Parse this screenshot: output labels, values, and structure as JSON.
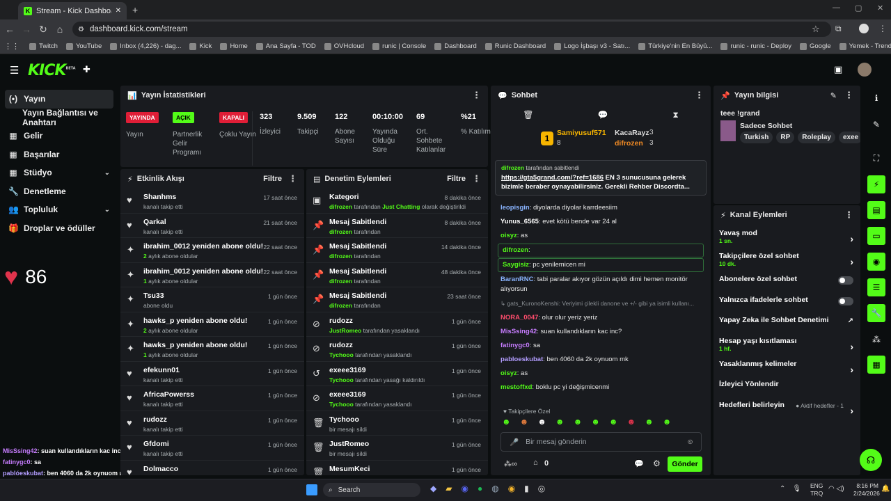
{
  "browser": {
    "tab_title": "Stream - Kick Dashboard",
    "url": "dashboard.kick.com/stream",
    "bookmarks": [
      "Twitch",
      "YouTube",
      "Inbox (4,226) - dag...",
      "Kick",
      "Home",
      "Ana Sayfa - TOD",
      "OVHcloud",
      "runic | Console",
      "Dashboard",
      "Runic Dashboard",
      "Logo İşbaşı v3 - Satı...",
      "Türkiye'nin En Büyü...",
      "runic - runic - Deploy",
      "Google",
      "Yemek - Trendyol Go"
    ]
  },
  "header": {
    "logo": "KICK",
    "beta": "BETA"
  },
  "sidebar": {
    "items": [
      {
        "icon": "(•)",
        "label": "Yayın",
        "active": true
      },
      {
        "icon": "",
        "label": "Yayın Bağlantısı ve Anahtarı"
      },
      {
        "icon": "▦",
        "label": "Gelir"
      },
      {
        "icon": "▦",
        "label": "Başarılar"
      },
      {
        "icon": "▦",
        "label": "Stüdyo",
        "chev": "⌄"
      },
      {
        "icon": "🔧",
        "label": "Denetleme"
      },
      {
        "icon": "👥",
        "label": "Topluluk",
        "chev": "⌄"
      },
      {
        "icon": "🎁",
        "label": "Droplar ve ödüller"
      }
    ],
    "heart_rate": "86"
  },
  "overlay_chat": [
    {
      "name": "MisSsing42",
      "text": ": suan kullandıkların kac inc?",
      "color": "#c77dff"
    },
    {
      "name": "fatinygc0",
      "text": ": sa",
      "color": "#c77dff"
    },
    {
      "name": "pablóeskubat",
      "text": ": ben 4060 da 2k oynuom mk",
      "color": "#b39dff"
    },
    {
      "name": "oisyz",
      "text": ": as",
      "color": "#53fc18"
    },
    {
      "name": "mestoffxd",
      "text": ": boklu pc yi değişmicenmi",
      "color": "#53fc18"
    }
  ],
  "stats": {
    "title": "Yayın İstatistikleri",
    "badges": [
      {
        "text": "YAYINDA",
        "label": "Yayın",
        "bg": "#e01e37",
        "fg": "#fff"
      },
      {
        "text": "AÇIK",
        "label": "Partnerlik Gelir Programı",
        "bg": "#53fc18",
        "fg": "#000"
      },
      {
        "text": "KAPALI",
        "label": "Çoklu Yayın",
        "bg": "#e01e37",
        "fg": "#fff"
      }
    ],
    "values": [
      {
        "v": "323",
        "l": "İzleyici"
      },
      {
        "v": "9.509",
        "l": "Takipçi"
      },
      {
        "v": "122",
        "l": "Abone Sayısı"
      },
      {
        "v": "00:10:00",
        "l": "Yayında Olduğu Süre"
      },
      {
        "v": "69",
        "l": "Ort. Sohbete Katılanlar"
      },
      {
        "v": "%21",
        "l": "% Katılım"
      }
    ]
  },
  "activity": {
    "title": "Etkinlik Akışı",
    "filter": "Filtre",
    "rows": [
      {
        "icon": "♥",
        "t": "Shanhms",
        "s": "kanalı takip etti",
        "time": "17 saat önce"
      },
      {
        "icon": "♥",
        "t": "Qarkal",
        "s": "kanalı takip etti",
        "time": "21 saat önce"
      },
      {
        "icon": "✦",
        "t": "ibrahim_0012 yeniden abone oldu!",
        "s2": "2",
        "s": " aylık abone oldular",
        "time": "22 saat önce"
      },
      {
        "icon": "✦",
        "t": "ibrahim_0012 yeniden abone oldu!",
        "s2": "1",
        "s": " aylık abone oldular",
        "time": "22 saat önce"
      },
      {
        "icon": "✦",
        "t": "Tsu33",
        "s": "abone oldu",
        "time": "1 gün önce"
      },
      {
        "icon": "✦",
        "t": "hawks_p yeniden abone oldu!",
        "s2": "2",
        "s": " aylık abone oldular",
        "time": "1 gün önce"
      },
      {
        "icon": "✦",
        "t": "hawks_p yeniden abone oldu!",
        "s2": "1",
        "s": " aylık abone oldular",
        "time": "1 gün önce"
      },
      {
        "icon": "♥",
        "t": "efekunn01",
        "s": "kanalı takip etti",
        "time": "1 gün önce"
      },
      {
        "icon": "♥",
        "t": "AfricaPowerss",
        "s": "kanalı takip etti",
        "time": "1 gün önce"
      },
      {
        "icon": "♥",
        "t": "rudozz",
        "s": "kanalı takip etti",
        "time": "1 gün önce"
      },
      {
        "icon": "♥",
        "t": "Gfdomi",
        "s": "kanalı takip etti",
        "time": "1 gün önce"
      },
      {
        "icon": "♥",
        "t": "Dolmacco",
        "s": "",
        "time": "1 gün önce"
      }
    ]
  },
  "moderation": {
    "title": "Denetim Eylemleri",
    "filter": "Filtre",
    "rows": [
      {
        "icon": "▣",
        "t": "Kategori",
        "g": "difrozen",
        "s": " tarafından ",
        "g2": "Just Chatting",
        "s3": " olarak değiştirildi",
        "time": "8 dakika önce"
      },
      {
        "icon": "📌",
        "t": "Mesaj Sabitlendi",
        "g": "difrozen",
        "s": " tarafından",
        "time": "8 dakika önce"
      },
      {
        "icon": "📌",
        "t": "Mesaj Sabitlendi",
        "g": "difrozen",
        "s": " tarafından",
        "time": "14 dakika önce"
      },
      {
        "icon": "📌",
        "t": "Mesaj Sabitlendi",
        "g": "difrozen",
        "s": " tarafından",
        "time": "48 dakika önce"
      },
      {
        "icon": "📌",
        "t": "Mesaj Sabitlendi",
        "g": "difrozen",
        "s": " tarafından",
        "time": "23 saat önce"
      },
      {
        "icon": "⊘",
        "t": "rudozz",
        "g": "JustRomeo",
        "s": " tarafından yasaklandı",
        "time": "1 gün önce"
      },
      {
        "icon": "⊘",
        "t": "rudozz",
        "g": "Tychooo",
        "s": " tarafından yasaklandı",
        "time": "1 gün önce"
      },
      {
        "icon": "↺",
        "t": "exeee3169",
        "g": "Tychooo",
        "s": " tarafından yasağı kaldırıldı",
        "time": "1 gün önce"
      },
      {
        "icon": "⊘",
        "t": "exeee3169",
        "g": "Tychooo",
        "s": " tarafından yasaklandı",
        "time": "1 gün önce"
      },
      {
        "icon": "🗑",
        "t": "Tychooo",
        "s": "bir mesajı sildi",
        "time": "1 gün önce"
      },
      {
        "icon": "🗑",
        "t": "JustRomeo",
        "s": "bir mesajı sildi",
        "time": "1 gün önce"
      },
      {
        "icon": "🗑",
        "t": "MesumKeci",
        "s": "",
        "time": "1 gün önce"
      }
    ]
  },
  "chat": {
    "title": "Sohbet",
    "top": [
      {
        "name": "Samiyusuf571",
        "rank": "8"
      },
      {
        "name": "KacaRayz",
        "rank": "3"
      },
      {
        "name": "difrozen",
        "rank": "3"
      }
    ],
    "pinned_by": "difrozen",
    "pinned_suffix": " tarafından sabitlendi",
    "pinned_link": "https://gta5grand.com/?ref=1686",
    "pinned_text": " EN 3 sunucusuna gelerek bizimle beraber oynayabilirsiniz. Gerekli Rehber Discordta...",
    "messages": [
      {
        "name": "leopisgin",
        "color": "#8ab4ff",
        "text": ": diyolarda diyolar karrdeesiim"
      },
      {
        "name": "Yunus_6565",
        "color": "#ffffff",
        "text": ": evet kötü bende var 24 al"
      },
      {
        "name": "oisyz",
        "color": "#53fc18",
        "text": ": as"
      },
      {
        "name": "difrozen",
        "color": "#53fc18",
        "text": ":"
      },
      {
        "name": "Saygisiz",
        "color": "#53fc18",
        "text": ": pc yenilemicen mi"
      },
      {
        "name": "BaranRNC",
        "color": "#8ab4ff",
        "text": ": tabi paralar akıyor gözün açıldı dimi hemen monitör alıyorsun"
      },
      {
        "reply": "↳ gats_KuronoKenshi: Veriyimi çilekli danone ve +/- gibi ya isimli kullanı..."
      },
      {
        "name": "NORA_0047",
        "color": "#ff4d6d",
        "text": ": olur olur yeriz yeriz"
      },
      {
        "name": "MisSsing42",
        "color": "#c77dff",
        "text": ": suan kullandıkların kac inc?"
      },
      {
        "name": "fatinygc0",
        "color": "#c77dff",
        "text": ": sa"
      },
      {
        "name": "pabloeskubat",
        "color": "#b39dff",
        "text": ": ben 4060 da 2k oynuom mk"
      },
      {
        "name": "oisyz",
        "color": "#53fc18",
        "text": ": as"
      },
      {
        "name": "mestoffxd",
        "color": "#53fc18",
        "text": ": boklu pc yi değişmicenmi"
      }
    ],
    "followers_only": "Takipçilere Özel",
    "placeholder": "Bir mesaj gönderin",
    "send": "Gönder",
    "count": "0"
  },
  "stream_info": {
    "title": "Yayın bilgisi",
    "stream_title": "teee !grand",
    "category": "Sadece Sohbet",
    "tags": [
      "Turkish",
      "RP",
      "Roleplay",
      "exee"
    ]
  },
  "channel_actions": {
    "title": "Kanal Eylemleri",
    "items": [
      {
        "label": "Yavaş mod",
        "sub": "1 sn.",
        "type": "arrow"
      },
      {
        "label": "Takipçilere özel sohbet",
        "sub": "10 dk.",
        "type": "arrow"
      },
      {
        "label": "Abonelere özel sohbet",
        "type": "toggle"
      },
      {
        "label": "Yalnızca ifadelerle sohbet",
        "type": "toggle"
      },
      {
        "label": "Yapay Zeka ile Sohbet Denetimi",
        "type": "ext"
      },
      {
        "label": "Hesap yaşı kısıtlaması",
        "sub": "1 hf.",
        "type": "arrow"
      },
      {
        "label": "Yasaklanmış kelimeler",
        "type": "arrow"
      },
      {
        "label": "İzleyici Yönlendir",
        "type": "none"
      },
      {
        "label": "Hedefleri belirleyin",
        "extra": "● Aktif hedefler - 1",
        "type": "arrow"
      }
    ]
  },
  "taskbar": {
    "search": "Search",
    "lang1": "ENG",
    "lang2": "TRQ",
    "time": "8:16 PM",
    "date": "2/24/2026"
  },
  "colors": {
    "accent": "#53fc18",
    "panel": "#191b1f",
    "bg": "#0b0e0f",
    "live": "#e01e37"
  }
}
